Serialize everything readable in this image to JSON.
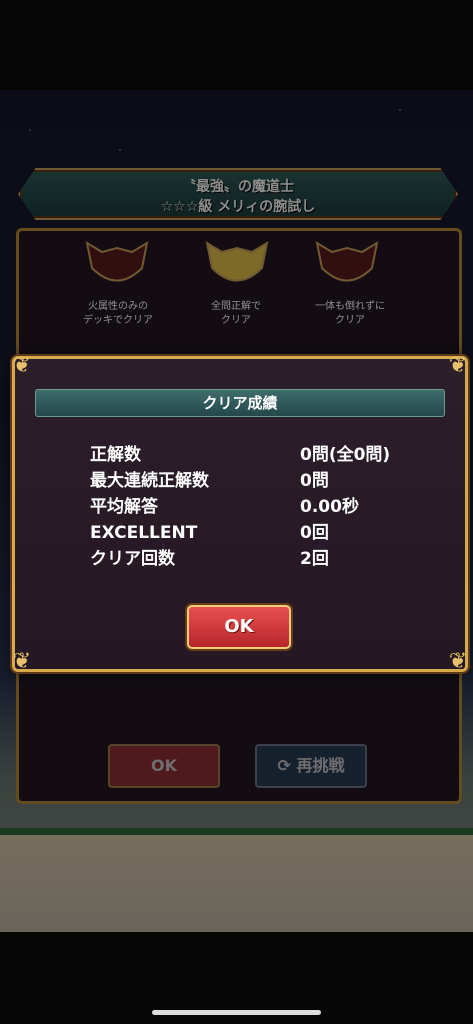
{
  "quest": {
    "title_line1": "〝最強〟の魔道士",
    "title_line2": "☆☆☆級 メリィの腕試し"
  },
  "badges": [
    {
      "label": "火属性のみの\nデッキでクリア",
      "color": "#5a1a1e"
    },
    {
      "label": "全問正解で\nクリア",
      "color": "#e6c24a"
    },
    {
      "label": "一体も倒れずに\nクリア",
      "color": "#5a1a1e"
    }
  ],
  "background_buttons": {
    "ok_label": "OK",
    "retry_label": "再挑戦"
  },
  "dialog": {
    "header": "クリア成績",
    "stats": [
      {
        "key": "正解数",
        "value": "0問(全0問)"
      },
      {
        "key": "最大連続正解数",
        "value": "0問"
      },
      {
        "key": "平均解答",
        "value": "0.00秒"
      },
      {
        "key": "EXCELLENT",
        "value": "0回"
      },
      {
        "key": "クリア回数",
        "value": "2回"
      }
    ],
    "ok_label": "OK"
  },
  "colors": {
    "gold_border": "#d5a94c",
    "ok_red": "#d93c40",
    "header_teal": "#3f6d6a"
  }
}
